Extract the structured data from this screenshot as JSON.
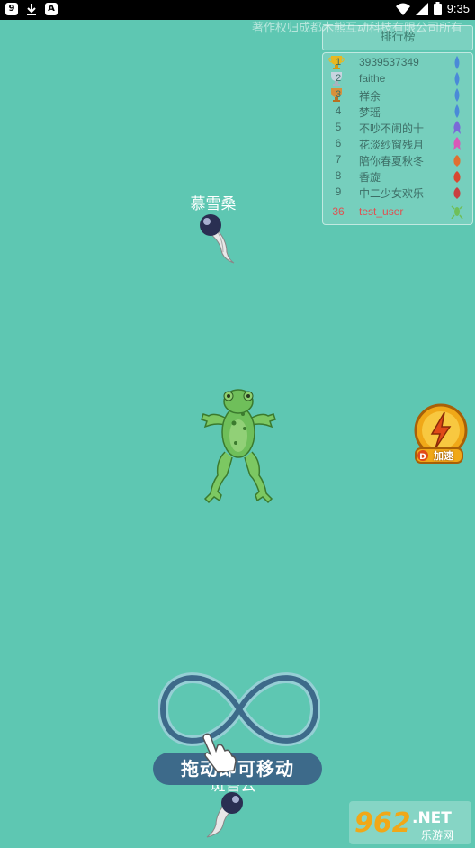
{
  "status_bar": {
    "time": "9:35",
    "icon1": "9",
    "icon3": "A"
  },
  "copyright": "著作权归成都木熊互动科技有限公司所有",
  "leaderboard": {
    "title": "排行榜",
    "rows": [
      {
        "rank": "1",
        "name": "3939537349"
      },
      {
        "rank": "2",
        "name": "faithe"
      },
      {
        "rank": "3",
        "name": "祥余"
      },
      {
        "rank": "4",
        "name": "梦瑶"
      },
      {
        "rank": "5",
        "name": "不吵不闹的十"
      },
      {
        "rank": "6",
        "name": "花淡纱窗残月"
      },
      {
        "rank": "7",
        "name": "陪你春夏秋冬"
      },
      {
        "rank": "8",
        "name": "香旋"
      },
      {
        "rank": "9",
        "name": "中二少女欢乐"
      },
      {
        "rank": "36",
        "name": "test_user"
      }
    ]
  },
  "players": {
    "top_name": "慕雪桑",
    "bottom_name": "斑苔云"
  },
  "boost_button": {
    "label": "加速"
  },
  "tutorial": {
    "text": "拖动即可移动"
  },
  "watermark": {
    "brand": "962",
    "net": ".NET",
    "sub": "乐游网"
  },
  "colors": {
    "background": "#5ec7b2",
    "frog": "#6fbf5a",
    "banner": "#3d6a8a",
    "me": "#e05050"
  }
}
